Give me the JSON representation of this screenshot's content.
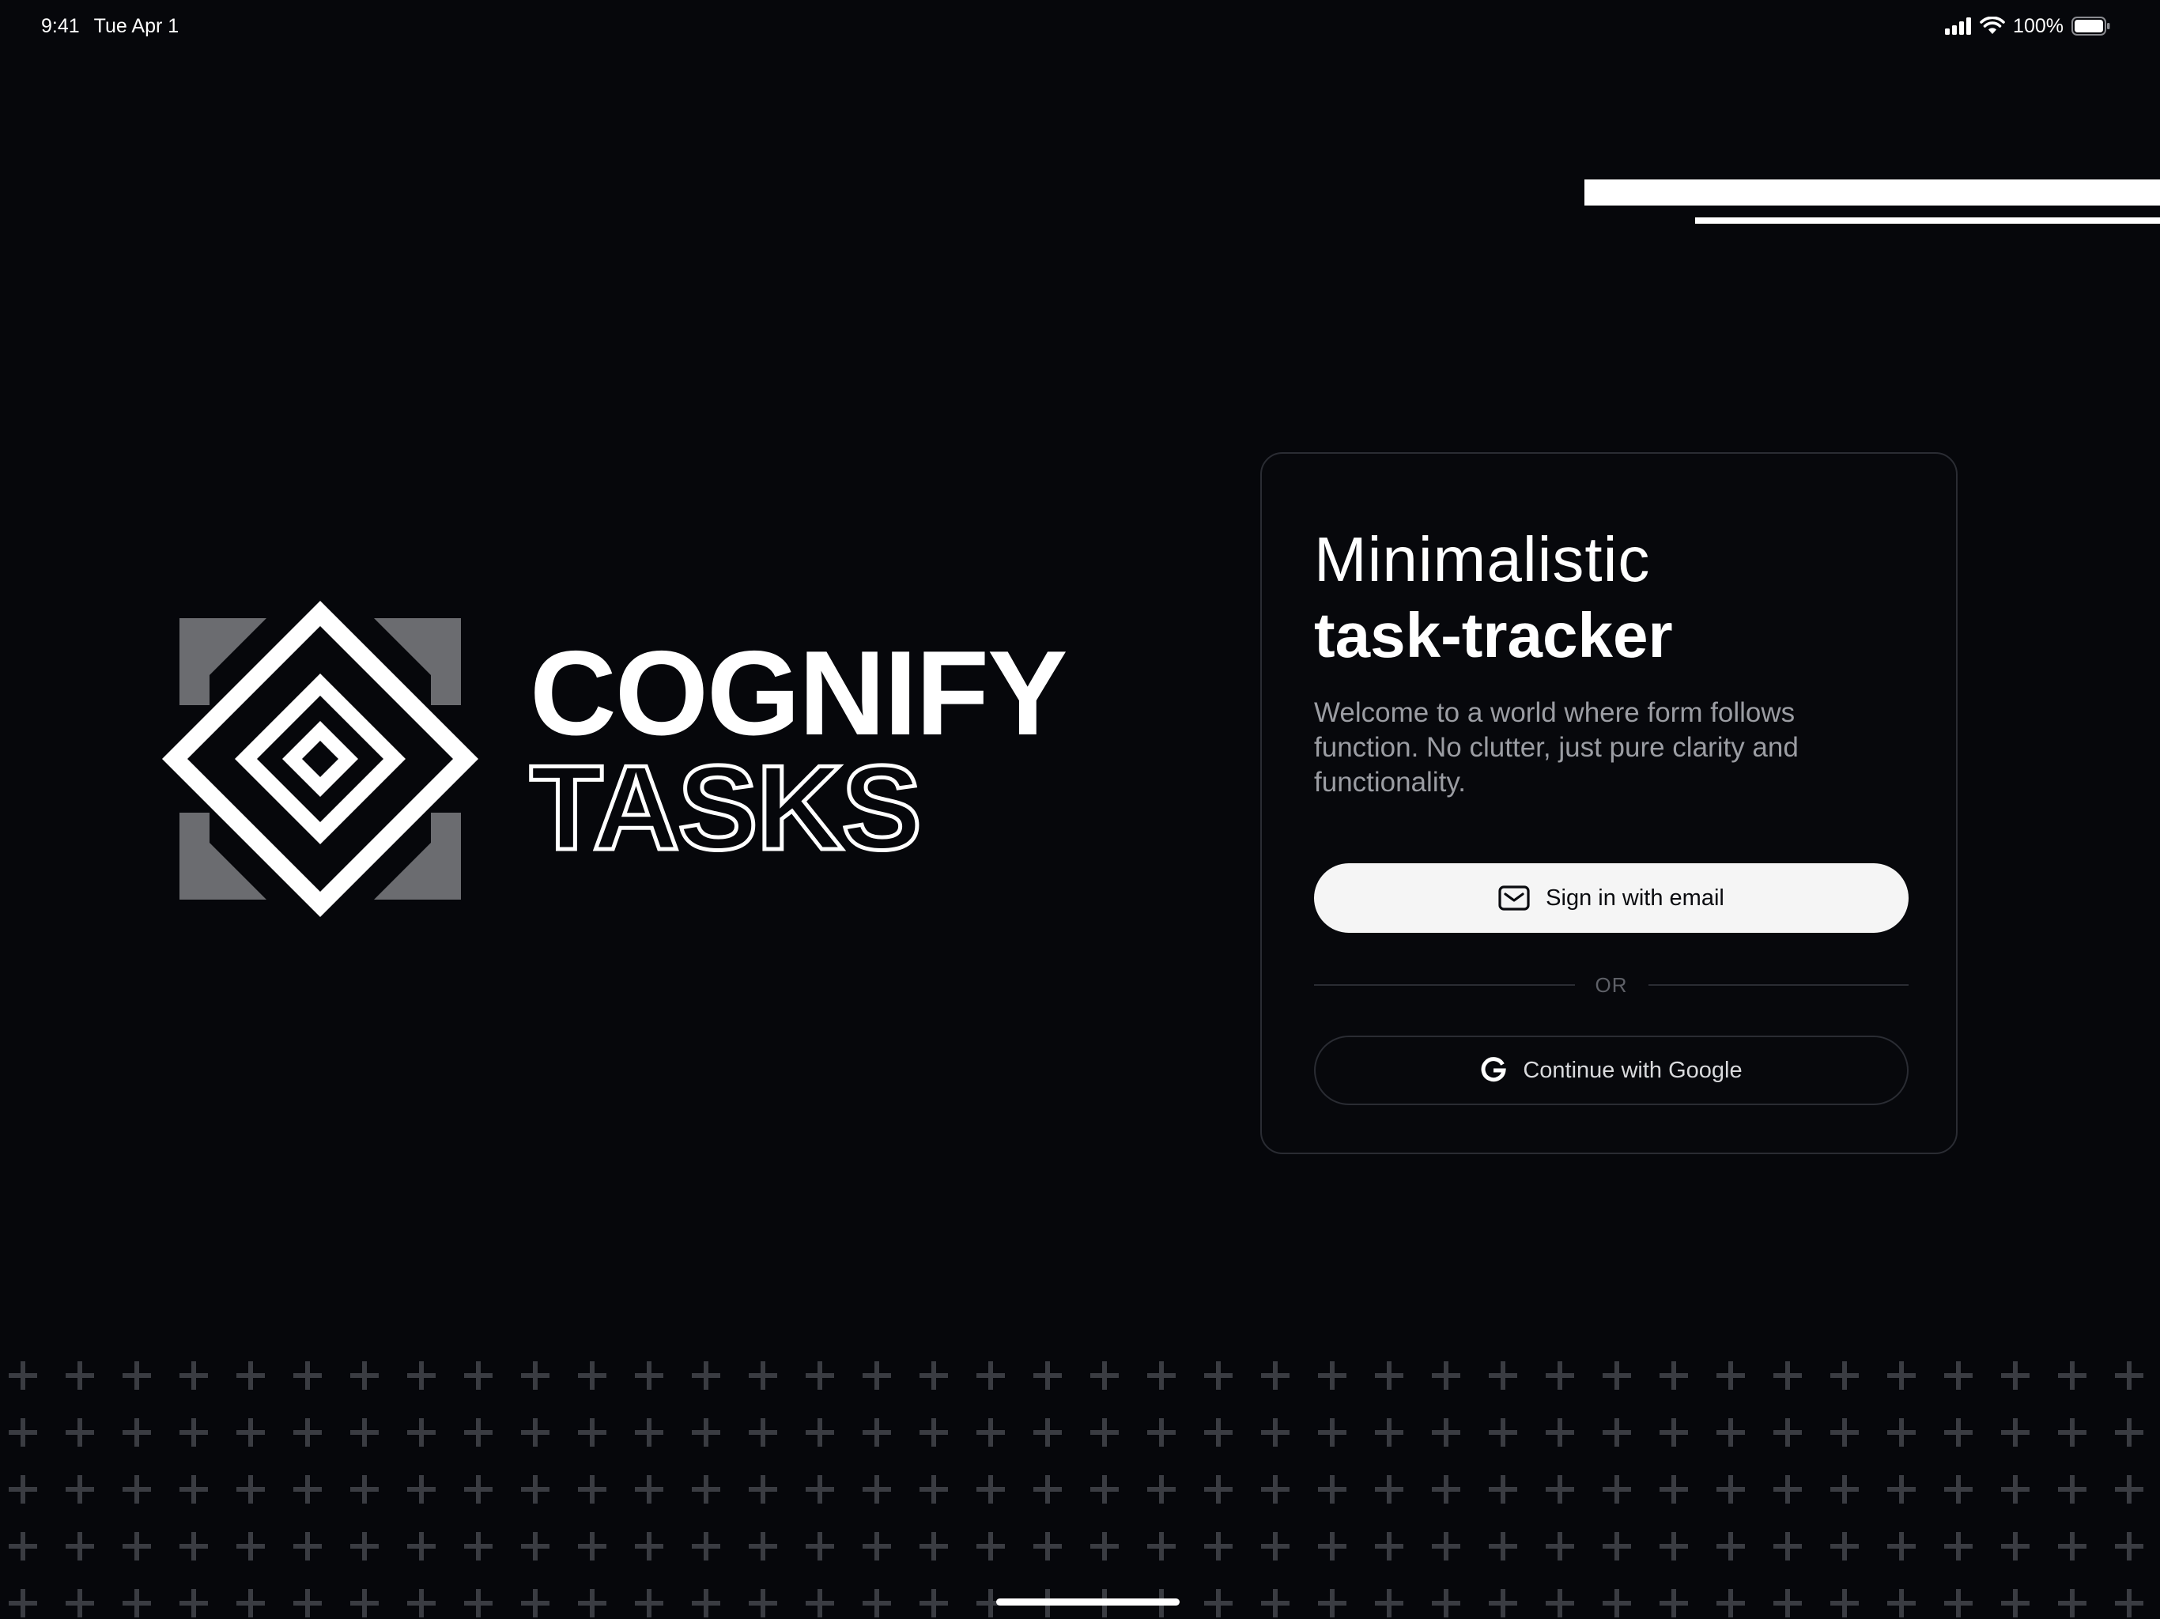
{
  "status_bar": {
    "time": "9:41",
    "date": "Tue Apr 1",
    "battery_percent": "100%",
    "icons": [
      "cellular-signal-icon",
      "wifi-icon",
      "battery-icon"
    ]
  },
  "logo": {
    "icon": "concentric-diamond-logo-icon",
    "word_top": "COGNIFY",
    "word_bottom": "TASKS"
  },
  "card": {
    "headline_light": "Minimalistic",
    "headline_bold": "task-tracker",
    "description": "Welcome to a world where form follows function. No clutter, just pure clarity and functionality.",
    "email_button_label": "Sign in with email",
    "email_button_icon": "mail-icon",
    "divider_label": "OR",
    "google_button_label": "Continue with Google",
    "google_button_icon": "google-g-icon"
  },
  "colors": {
    "background": "#06070b",
    "primary_text": "#ffffff",
    "muted_text": "#9b9da3",
    "card_border": "#2a2c33",
    "pattern": "#3a3c42"
  }
}
